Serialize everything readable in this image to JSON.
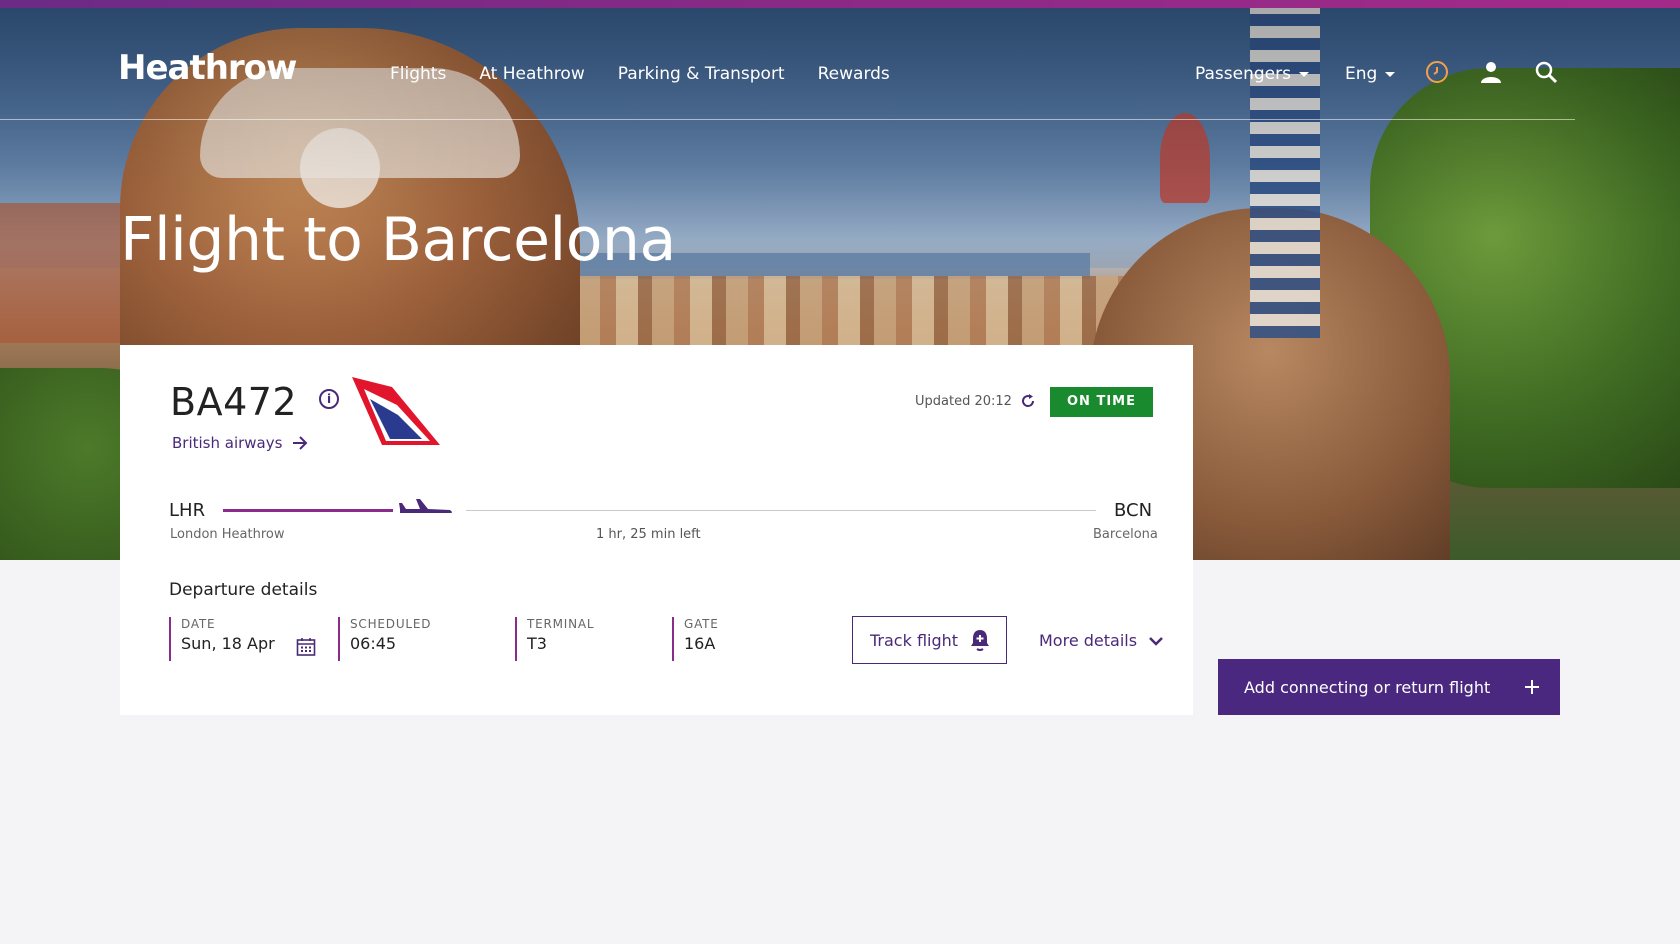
{
  "brand": {
    "logo": "Heathrow"
  },
  "nav": {
    "links": [
      "Flights",
      "At Heathrow",
      "Parking & Transport",
      "Rewards"
    ],
    "passengers": "Passengers",
    "language": "Eng"
  },
  "hero": {
    "title": "Flight to Barcelona"
  },
  "flight": {
    "number": "BA472",
    "info_icon": "i",
    "airline": "British airways",
    "updated": "Updated 20:12",
    "status": "ON TIME",
    "origin": {
      "code": "LHR",
      "name": "London Heathrow"
    },
    "destination": {
      "code": "BCN",
      "name": "Barcelona"
    },
    "time_left": "1 hr, 25 min left",
    "progress": 0.29
  },
  "departure": {
    "title": "Departure details",
    "date": {
      "label": "DATE",
      "value": "Sun, 18 Apr"
    },
    "scheduled": {
      "label": "SCHEDULED",
      "value": "06:45"
    },
    "terminal": {
      "label": "TERMINAL",
      "value": "T3"
    },
    "gate": {
      "label": "GATE",
      "value": "16A"
    }
  },
  "actions": {
    "track": "Track flight",
    "more": "More details",
    "connect": "Add connecting or return flight"
  },
  "colors": {
    "accent": "#4a2a78",
    "progress": "#8a2c8c",
    "status": "#1a8a2f",
    "clock": "#f2a14a"
  }
}
